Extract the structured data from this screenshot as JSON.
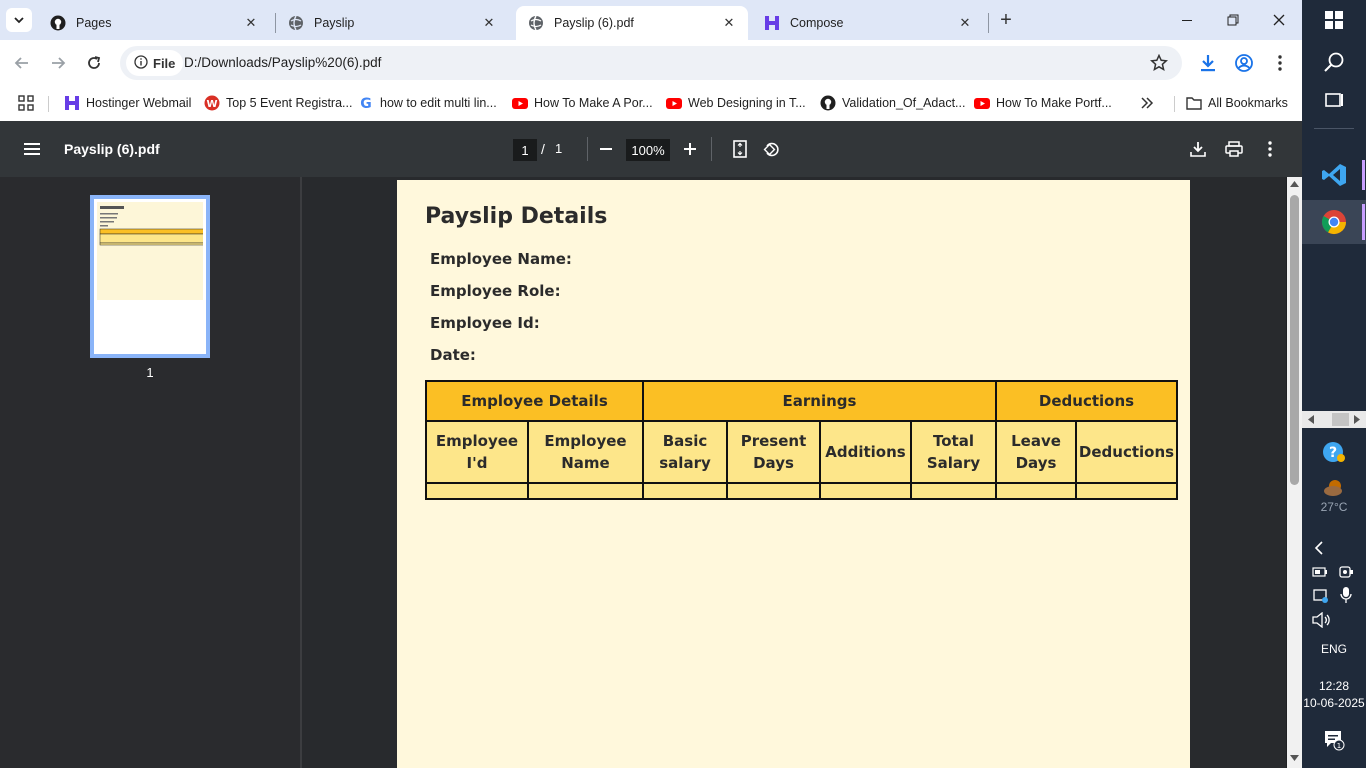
{
  "tabs": [
    {
      "title": "Pages",
      "icon": "github-icon",
      "active": false
    },
    {
      "title": "Payslip",
      "icon": "globe-icon",
      "active": false
    },
    {
      "title": "Payslip (6).pdf",
      "icon": "globe-icon",
      "active": true
    },
    {
      "title": "Compose",
      "icon": "hostinger-icon",
      "active": false
    }
  ],
  "toolbar": {
    "file_chip": "File",
    "url": "D:/Downloads/Payslip%20(6).pdf"
  },
  "bookmarks": [
    {
      "label": "Hostinger Webmail",
      "icon": "hostinger-icon"
    },
    {
      "label": "Top 5 Event Registra...",
      "icon": "w-icon"
    },
    {
      "label": "how to edit multi lin...",
      "icon": "google-icon"
    },
    {
      "label": "How To Make A Por...",
      "icon": "youtube-icon"
    },
    {
      "label": "Web Designing in T...",
      "icon": "youtube-icon"
    },
    {
      "label": "Validation_Of_Adact...",
      "icon": "github-icon"
    },
    {
      "label": "How To Make Portf...",
      "icon": "youtube-icon"
    }
  ],
  "all_bookmarks": "All Bookmarks",
  "pdf": {
    "title": "Payslip (6).pdf",
    "page": "1",
    "page_sep": "/",
    "page_total": "1",
    "zoom": "100%",
    "thumb_number": "1"
  },
  "document": {
    "title": "Payslip Details",
    "fields": [
      "Employee Name:",
      "Employee Role:",
      "Employee Id:",
      "Date:"
    ],
    "groups": [
      "Employee Details",
      "Earnings",
      "Deductions"
    ],
    "columns": [
      [
        "Employee",
        "I'd"
      ],
      [
        "Employee",
        "Name"
      ],
      [
        "Basic",
        "salary"
      ],
      [
        "Present",
        "Days"
      ],
      [
        "Additions"
      ],
      [
        "Total",
        "Salary"
      ],
      [
        "Leave",
        "Days"
      ],
      [
        "Deductions"
      ]
    ]
  },
  "taskbar": {
    "weather": "27°C",
    "lang": "ENG",
    "time": "12:28",
    "date": "10-06-2025"
  }
}
